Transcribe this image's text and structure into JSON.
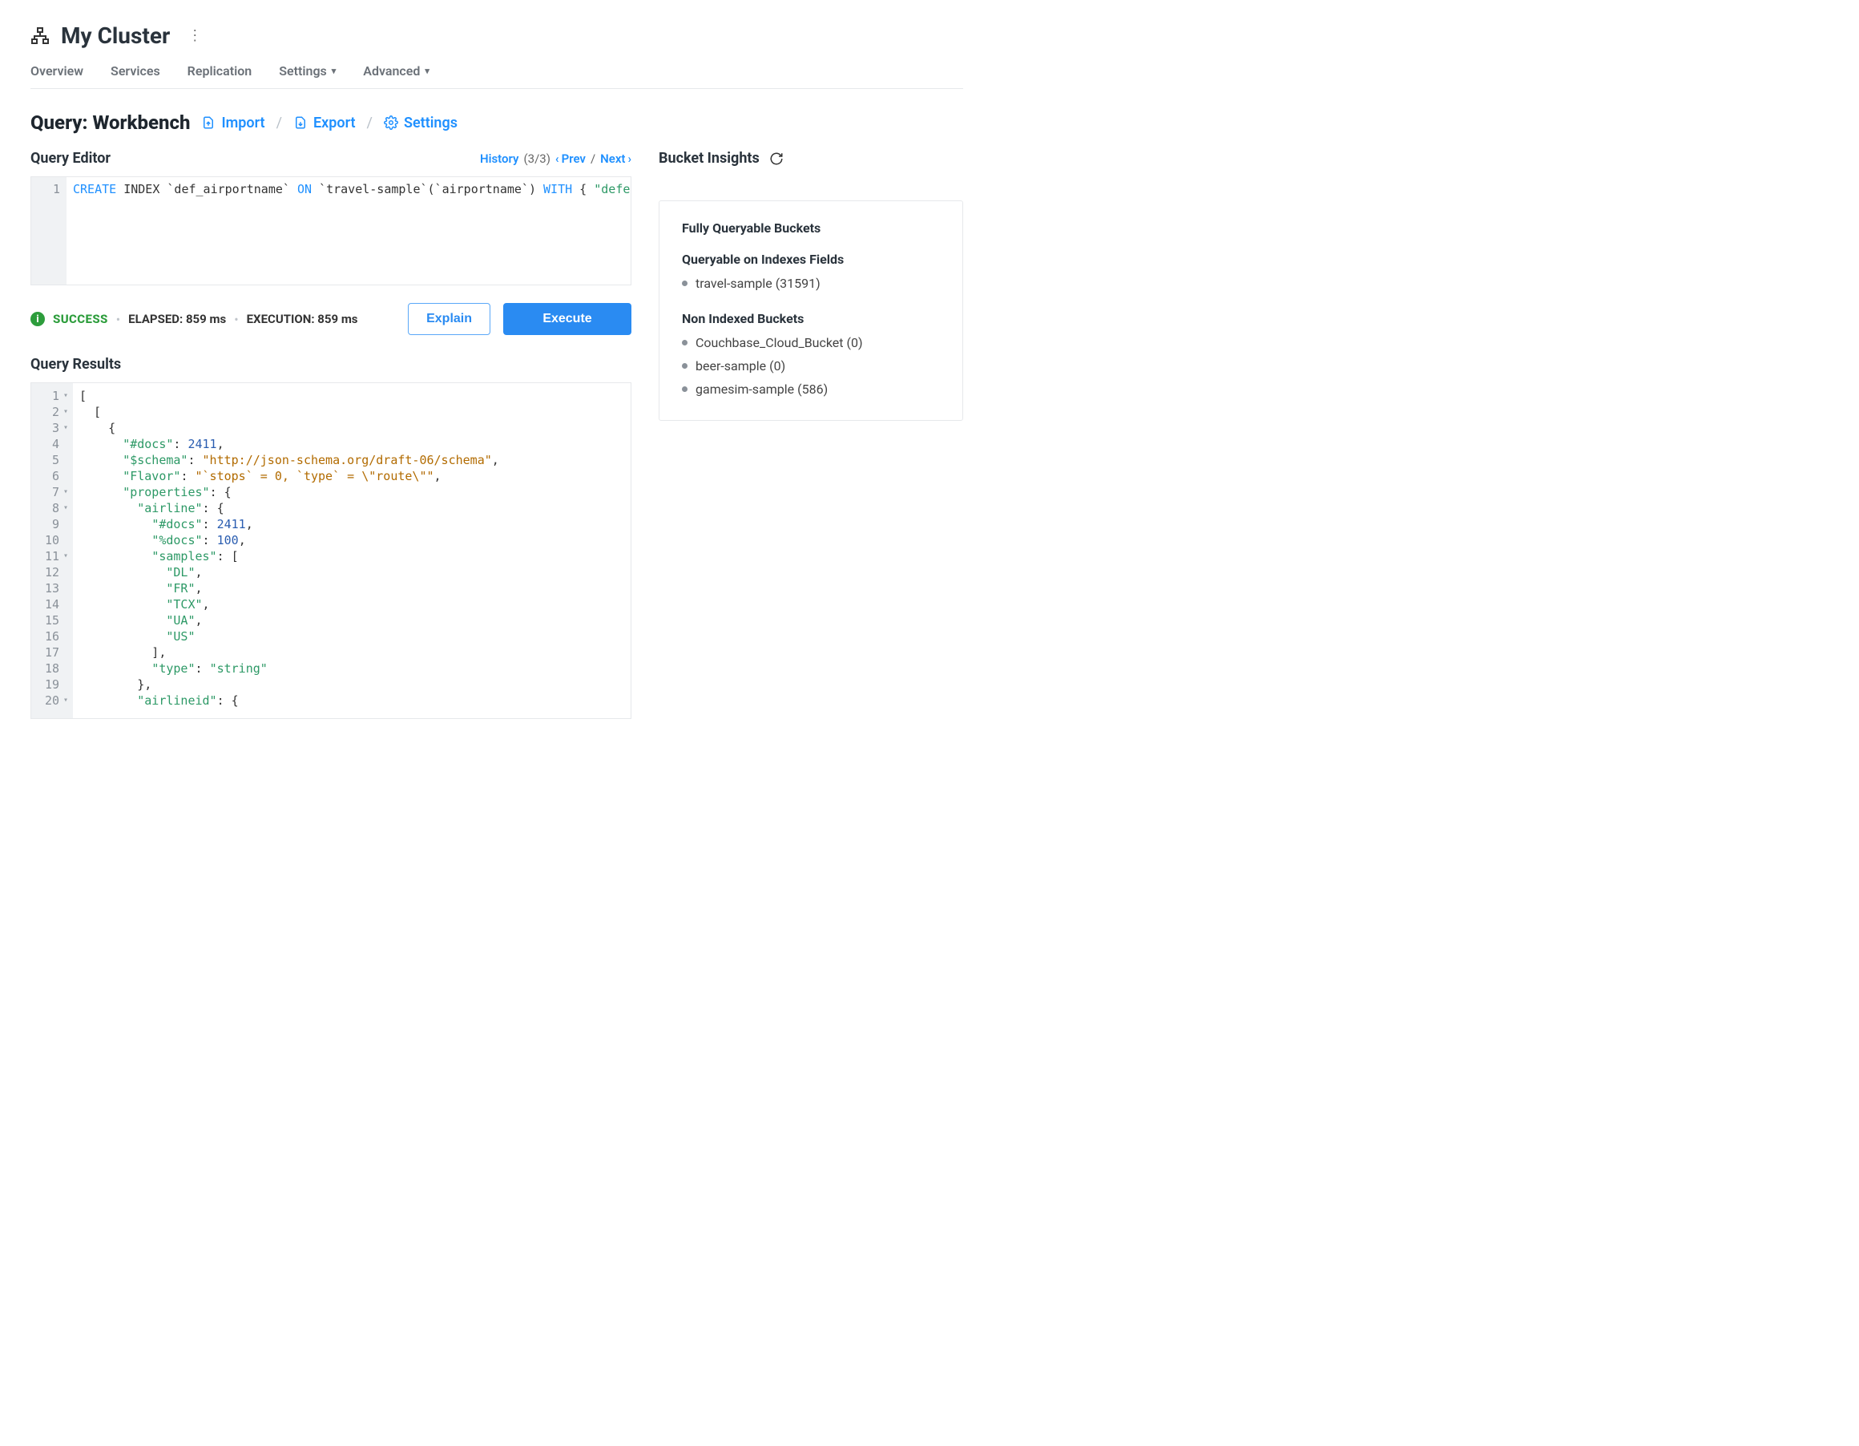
{
  "header": {
    "cluster_name": "My Cluster",
    "tabs": [
      "Overview",
      "Services",
      "Replication",
      "Settings",
      "Advanced"
    ]
  },
  "page": {
    "title": "Query: Workbench",
    "actions": {
      "import": "Import",
      "export": "Export",
      "settings": "Settings"
    }
  },
  "editor": {
    "title": "Query Editor",
    "history_label": "History",
    "history_count": "(3/3)",
    "prev_label": "Prev",
    "next_label": "Next",
    "line_number": "1",
    "query_tokens": [
      {
        "t": "kw",
        "v": "CREATE"
      },
      {
        "t": "id",
        "v": " INDEX `def_airportname` "
      },
      {
        "t": "kw",
        "v": "ON"
      },
      {
        "t": "id",
        "v": " `travel-sample`(`airportname`) "
      },
      {
        "t": "kw",
        "v": "WITH"
      },
      {
        "t": "id",
        "v": " {  "
      },
      {
        "t": "str",
        "v": "\"defer"
      }
    ]
  },
  "status": {
    "success": "SUCCESS",
    "elapsed_label": "ELAPSED: 859 ms",
    "execution_label": "EXECUTION: 859 ms",
    "explain_btn": "Explain",
    "execute_btn": "Execute"
  },
  "results": {
    "title": "Query Results",
    "gutter": [
      {
        "n": "1",
        "fold": true
      },
      {
        "n": "2",
        "fold": true
      },
      {
        "n": "3",
        "fold": true
      },
      {
        "n": "4",
        "fold": false
      },
      {
        "n": "5",
        "fold": false
      },
      {
        "n": "6",
        "fold": false
      },
      {
        "n": "7",
        "fold": true
      },
      {
        "n": "8",
        "fold": true
      },
      {
        "n": "9",
        "fold": false
      },
      {
        "n": "10",
        "fold": false
      },
      {
        "n": "11",
        "fold": true
      },
      {
        "n": "12",
        "fold": false
      },
      {
        "n": "13",
        "fold": false
      },
      {
        "n": "14",
        "fold": false
      },
      {
        "n": "15",
        "fold": false
      },
      {
        "n": "16",
        "fold": false
      },
      {
        "n": "17",
        "fold": false
      },
      {
        "n": "18",
        "fold": false
      },
      {
        "n": "19",
        "fold": false
      },
      {
        "n": "20",
        "fold": true
      }
    ],
    "lines": [
      [
        {
          "c": "j-punct",
          "v": "["
        }
      ],
      [
        {
          "c": "j-punct",
          "v": "  ["
        }
      ],
      [
        {
          "c": "j-punct",
          "v": "    {"
        }
      ],
      [
        {
          "c": "j-punct",
          "v": "      "
        },
        {
          "c": "j-key",
          "v": "\"#docs\""
        },
        {
          "c": "j-punct",
          "v": ": "
        },
        {
          "c": "j-num",
          "v": "2411"
        },
        {
          "c": "j-punct",
          "v": ","
        }
      ],
      [
        {
          "c": "j-punct",
          "v": "      "
        },
        {
          "c": "j-key",
          "v": "\"$schema\""
        },
        {
          "c": "j-punct",
          "v": ": "
        },
        {
          "c": "j-str2",
          "v": "\"http://json-schema.org/draft-06/schema\""
        },
        {
          "c": "j-punct",
          "v": ","
        }
      ],
      [
        {
          "c": "j-punct",
          "v": "      "
        },
        {
          "c": "j-key",
          "v": "\"Flavor\""
        },
        {
          "c": "j-punct",
          "v": ": "
        },
        {
          "c": "j-str2",
          "v": "\"`stops` = 0, `type` = \\\"route\\\"\""
        },
        {
          "c": "j-punct",
          "v": ","
        }
      ],
      [
        {
          "c": "j-punct",
          "v": "      "
        },
        {
          "c": "j-key",
          "v": "\"properties\""
        },
        {
          "c": "j-punct",
          "v": ": {"
        }
      ],
      [
        {
          "c": "j-punct",
          "v": "        "
        },
        {
          "c": "j-key",
          "v": "\"airline\""
        },
        {
          "c": "j-punct",
          "v": ": {"
        }
      ],
      [
        {
          "c": "j-punct",
          "v": "          "
        },
        {
          "c": "j-key",
          "v": "\"#docs\""
        },
        {
          "c": "j-punct",
          "v": ": "
        },
        {
          "c": "j-num",
          "v": "2411"
        },
        {
          "c": "j-punct",
          "v": ","
        }
      ],
      [
        {
          "c": "j-punct",
          "v": "          "
        },
        {
          "c": "j-key",
          "v": "\"%docs\""
        },
        {
          "c": "j-punct",
          "v": ": "
        },
        {
          "c": "j-num",
          "v": "100"
        },
        {
          "c": "j-punct",
          "v": ","
        }
      ],
      [
        {
          "c": "j-punct",
          "v": "          "
        },
        {
          "c": "j-key",
          "v": "\"samples\""
        },
        {
          "c": "j-punct",
          "v": ": ["
        }
      ],
      [
        {
          "c": "j-punct",
          "v": "            "
        },
        {
          "c": "j-str",
          "v": "\"DL\""
        },
        {
          "c": "j-punct",
          "v": ","
        }
      ],
      [
        {
          "c": "j-punct",
          "v": "            "
        },
        {
          "c": "j-str",
          "v": "\"FR\""
        },
        {
          "c": "j-punct",
          "v": ","
        }
      ],
      [
        {
          "c": "j-punct",
          "v": "            "
        },
        {
          "c": "j-str",
          "v": "\"TCX\""
        },
        {
          "c": "j-punct",
          "v": ","
        }
      ],
      [
        {
          "c": "j-punct",
          "v": "            "
        },
        {
          "c": "j-str",
          "v": "\"UA\""
        },
        {
          "c": "j-punct",
          "v": ","
        }
      ],
      [
        {
          "c": "j-punct",
          "v": "            "
        },
        {
          "c": "j-str",
          "v": "\"US\""
        }
      ],
      [
        {
          "c": "j-punct",
          "v": "          ],"
        }
      ],
      [
        {
          "c": "j-punct",
          "v": "          "
        },
        {
          "c": "j-key",
          "v": "\"type\""
        },
        {
          "c": "j-punct",
          "v": ": "
        },
        {
          "c": "j-str",
          "v": "\"string\""
        }
      ],
      [
        {
          "c": "j-punct",
          "v": "        },"
        }
      ],
      [
        {
          "c": "j-punct",
          "v": "        "
        },
        {
          "c": "j-key",
          "v": "\"airlineid\""
        },
        {
          "c": "j-punct",
          "v": ": {"
        }
      ]
    ]
  },
  "insights": {
    "title": "Bucket Insights",
    "groups": [
      {
        "title": "Fully Queryable Buckets",
        "items": []
      },
      {
        "title": "Queryable on Indexes Fields",
        "items": [
          "travel-sample (31591)"
        ]
      },
      {
        "title": "Non Indexed Buckets",
        "items": [
          "Couchbase_Cloud_Bucket (0)",
          "beer-sample (0)",
          "gamesim-sample (586)"
        ]
      }
    ]
  }
}
